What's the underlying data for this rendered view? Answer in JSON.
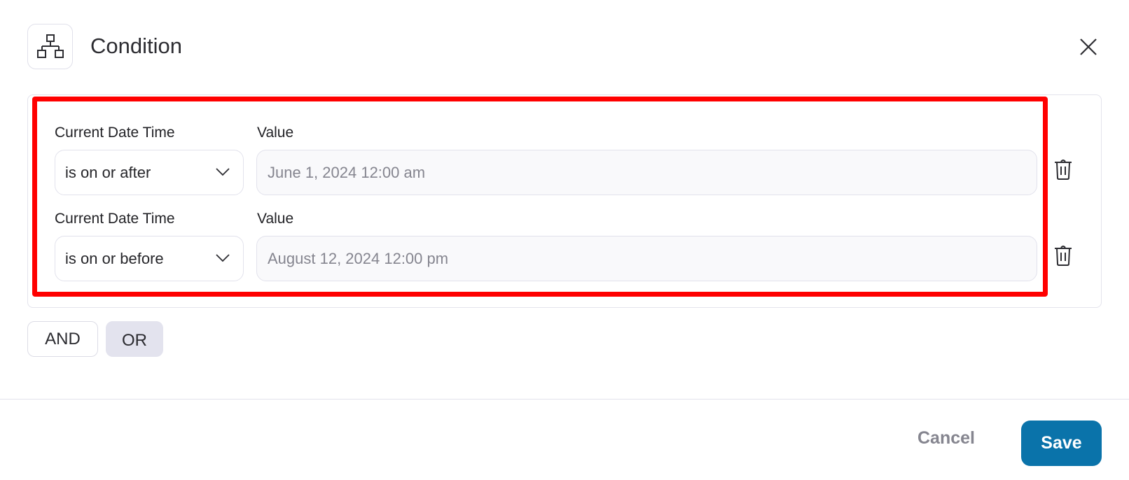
{
  "header": {
    "icon": "sitemap-icon",
    "title": "Condition",
    "close_icon": "close-icon"
  },
  "conditions": [
    {
      "field_label": "Current Date Time",
      "operator": "is on or after",
      "value_label": "Value",
      "value": "June 1, 2024 12:00 am",
      "delete_icon": "trash-icon"
    },
    {
      "field_label": "Current Date Time",
      "operator": "is on or before",
      "value_label": "Value",
      "value": "August 12, 2024 12:00 pm",
      "delete_icon": "trash-icon"
    }
  ],
  "logic": {
    "and_label": "AND",
    "or_label": "OR",
    "selected": "OR"
  },
  "footer": {
    "cancel_label": "Cancel",
    "save_label": "Save"
  },
  "colors": {
    "primary": "#0a73aa",
    "highlight": "#ff0000",
    "selected_logic_bg": "#e3e3ee"
  }
}
